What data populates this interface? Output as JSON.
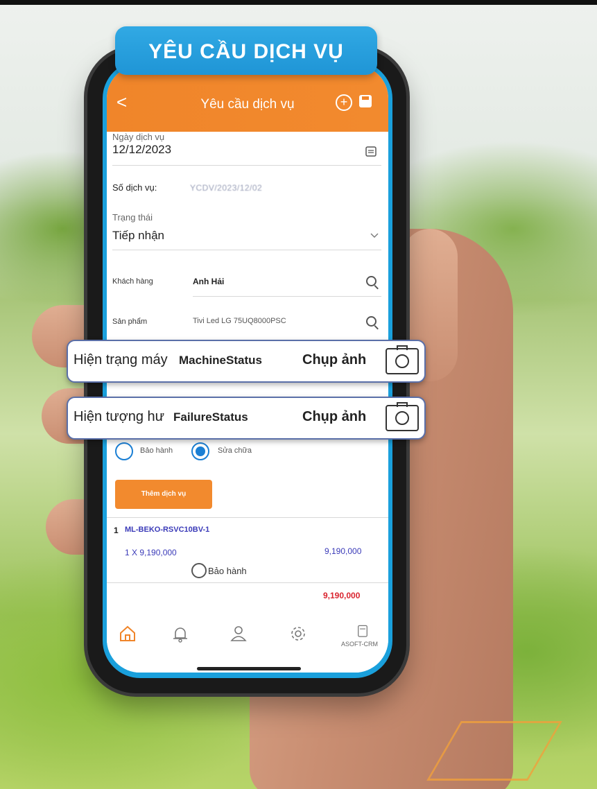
{
  "banner": {
    "title": "YÊU CẦU DỊCH VỤ"
  },
  "appbar": {
    "back": "<",
    "title": "Yêu cầu dịch vụ",
    "add": "+"
  },
  "form": {
    "service_date_label": "Ngày dịch vụ",
    "service_date_value": "12/12/2023",
    "service_number_label": "Số dịch vụ:",
    "service_number_value": "YCDV/2023/12/02",
    "status_label": "Trạng thái",
    "status_value": "Tiếp nhận",
    "customer_label": "Khách hàng",
    "customer_value": "Anh Hải",
    "product_label": "Sản phẩm",
    "product_value": "Tivi Led LG 75UQ8000PSC"
  },
  "overlays": [
    {
      "label": "Hiện trạng máy",
      "field": "MachineStatus",
      "action": "Chụp ảnh"
    },
    {
      "label": "Hiện tượng hư",
      "field": "FailureStatus",
      "action": "Chụp ảnh"
    }
  ],
  "service_type": {
    "warranty": "Bảo hành",
    "repair": "Sửa chữa",
    "selected": "Sửa chữa"
  },
  "add_service_button": "Thêm dịch vụ",
  "line_item": {
    "index": "1",
    "code": "ML-BEKO-RSVC10BV-1",
    "qty_price": "1 X 9,190,000",
    "amount": "9,190,000",
    "warranty_label": "Bảo hành"
  },
  "total": "9,190,000",
  "tabs": {
    "crm_label": "ASOFT-CRM"
  },
  "colors": {
    "accent_orange": "#f0852a",
    "accent_blue": "#1aa0dc"
  }
}
